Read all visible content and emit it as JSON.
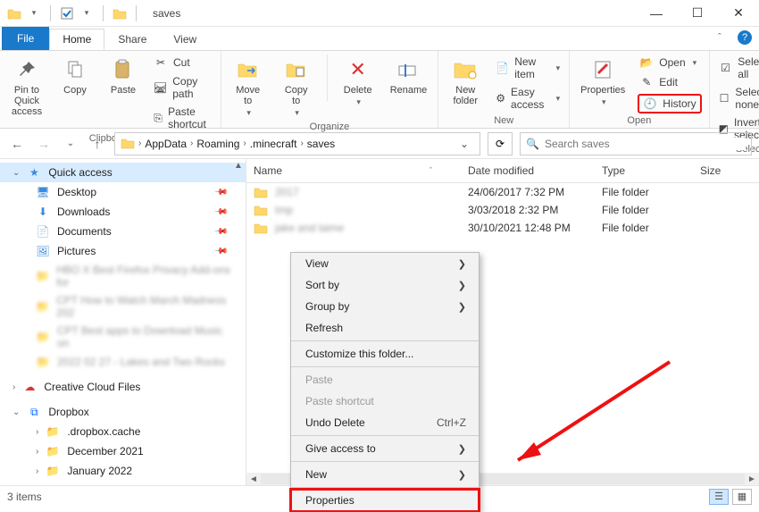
{
  "window": {
    "title": "saves"
  },
  "tabs": {
    "file": "File",
    "home": "Home",
    "share": "Share",
    "view": "View"
  },
  "ribbon": {
    "pin": "Pin to Quick\naccess",
    "copy": "Copy",
    "paste": "Paste",
    "cut": "Cut",
    "copy_path": "Copy path",
    "paste_shortcut": "Paste shortcut",
    "clipboard_group": "Clipboard",
    "move_to": "Move\nto",
    "copy_to": "Copy\nto",
    "delete": "Delete",
    "rename": "Rename",
    "organize_group": "Organize",
    "new_folder": "New\nfolder",
    "new_item": "New item",
    "easy_access": "Easy access",
    "new_group": "New",
    "properties": "Properties",
    "open": "Open",
    "edit": "Edit",
    "history": "History",
    "open_group": "Open",
    "select_all": "Select all",
    "select_none": "Select none",
    "invert_selection": "Invert selection",
    "select_group": "Select"
  },
  "breadcrumb": {
    "segments": [
      "AppData",
      "Roaming",
      ".minecraft",
      "saves"
    ]
  },
  "search": {
    "placeholder": "Search saves"
  },
  "nav": {
    "quick_access": "Quick access",
    "desktop": "Desktop",
    "downloads": "Downloads",
    "documents": "Documents",
    "pictures": "Pictures",
    "creative_cloud": "Creative Cloud Files",
    "dropbox": "Dropbox",
    "dropbox_cache": ".dropbox.cache",
    "december_2021": "December 2021",
    "january_2022": "January 2022"
  },
  "columns": {
    "name": "Name",
    "date": "Date modified",
    "type": "Type",
    "size": "Size"
  },
  "rows": [
    {
      "name": "2017",
      "date": "24/06/2017 7:32 PM",
      "type": "File folder"
    },
    {
      "name": "tmp",
      "date": "3/03/2018 2:32 PM",
      "type": "File folder"
    },
    {
      "name": "jake and laime",
      "date": "30/10/2021 12:48 PM",
      "type": "File folder"
    }
  ],
  "context_menu": {
    "view": "View",
    "sort_by": "Sort by",
    "group_by": "Group by",
    "refresh": "Refresh",
    "customize": "Customize this folder...",
    "paste": "Paste",
    "paste_shortcut": "Paste shortcut",
    "undo_delete": "Undo Delete",
    "undo_shortcut": "Ctrl+Z",
    "give_access": "Give access to",
    "new": "New",
    "properties": "Properties"
  },
  "status": {
    "count": "3 items"
  }
}
